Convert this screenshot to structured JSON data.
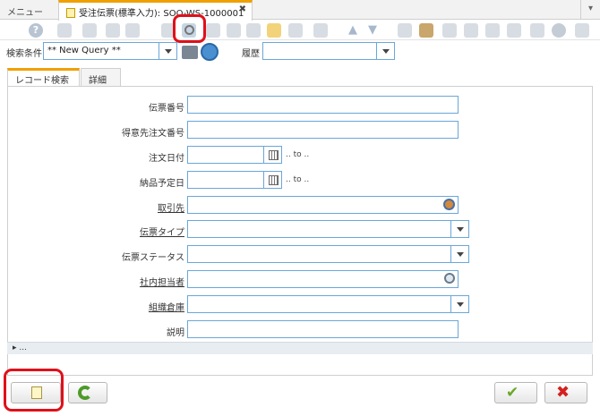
{
  "tabs": {
    "menu_label": "メニュー",
    "active_label": "受注伝票(標準入力): SOO-WS-1000001",
    "close_glyph": "✖"
  },
  "toolbar": {
    "icons": [
      "help-icon",
      "save-icon",
      "copy-icon",
      "delete-icon",
      "print-preview-icon",
      "search-icon",
      "attachment-icon",
      "chat-icon",
      "note-icon",
      "grid-toggle-icon",
      "history-icon",
      "arrow-up-icon",
      "arrow-down-icon",
      "report-icon",
      "archive-icon",
      "print-icon",
      "zoom-across-icon",
      "export-icon",
      "request-icon",
      "product-info-icon",
      "settings-icon",
      "workflow-icon"
    ]
  },
  "query": {
    "condition_label": "検索条件",
    "condition_value": "** New Query **",
    "history_label": "履歴",
    "history_value": ""
  },
  "inner_tabs": {
    "record_search": "レコード検索",
    "detail": "詳細"
  },
  "form": {
    "fields": [
      {
        "label": "伝票番号",
        "value": "",
        "link": false
      },
      {
        "label": "得意先注文番号",
        "value": "",
        "link": false
      },
      {
        "label": "注文日付",
        "value": "",
        "link": false,
        "to": ".. to .."
      },
      {
        "label": "納品予定日",
        "value": "",
        "link": false,
        "to": ".. to .."
      },
      {
        "label": "取引先",
        "value": "",
        "link": true
      },
      {
        "label": "伝票タイプ",
        "value": "",
        "link": true
      },
      {
        "label": "伝票ステータス",
        "value": "",
        "link": false
      },
      {
        "label": "社内担当者",
        "value": "",
        "link": true
      },
      {
        "label": "組織倉庫",
        "value": "",
        "link": true
      },
      {
        "label": "説明",
        "value": "",
        "link": false
      }
    ],
    "expand_label": "▸ ..."
  },
  "bottom": {
    "new_button": "new-record",
    "refresh_button": "refresh",
    "ok_button": "ok",
    "cancel_button": "cancel"
  },
  "colors": {
    "accent_tab": "#f0a000",
    "field_border": "#6aa7d8",
    "highlight": "#e0101a"
  }
}
